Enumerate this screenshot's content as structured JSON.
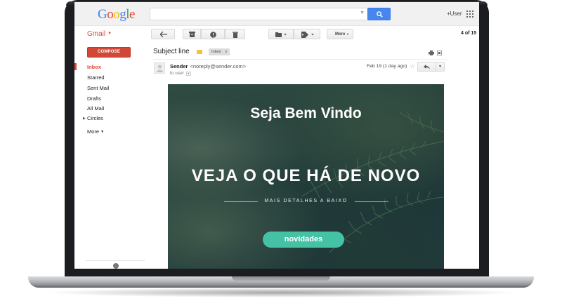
{
  "header": {
    "logo": "Google",
    "user_label": "+User",
    "search_placeholder": ""
  },
  "toolbar": {
    "app_label": "Gmail",
    "more_label": "More",
    "pagination": "4 of 15"
  },
  "sidebar": {
    "compose_label": "COMPOSE",
    "items": [
      {
        "label": "Inbox",
        "active": true
      },
      {
        "label": "Starred"
      },
      {
        "label": "Sent Mail"
      },
      {
        "label": "Drafts"
      },
      {
        "label": "All Mail"
      },
      {
        "label": "Circles"
      }
    ],
    "more_label": "More"
  },
  "message": {
    "subject": "Subject line",
    "tag": "Inbox",
    "tag_close": "x",
    "sender_name": "Sender",
    "sender_email": "<noreply@sender.com>",
    "to_label": "to user",
    "date": "Feb 19 (1 day ago)"
  },
  "email_body": {
    "title": "Seja Bem Vindo",
    "heading": "VEJA O QUE HÁ DE NOVO",
    "subheading": "MAIS DETALHES A BAIXO",
    "cta_label": "novidades"
  },
  "colors": {
    "gmail_red": "#dd4b39",
    "compose_red": "#d14836",
    "search_blue": "#4787ed",
    "cta_teal": "#45c1a5"
  }
}
